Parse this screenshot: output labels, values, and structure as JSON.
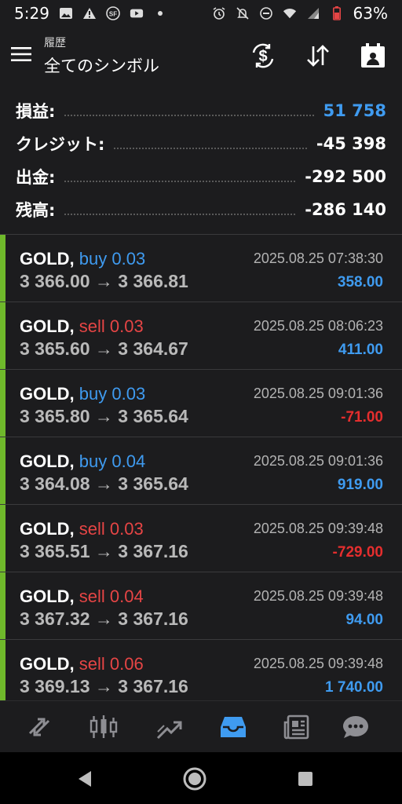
{
  "status_bar": {
    "time": "5:29",
    "battery": "63%",
    "icons_left": [
      "image-icon",
      "warning-icon",
      "sf-icon",
      "youtube-icon",
      "dot-icon"
    ],
    "icons_right": [
      "alarm-icon",
      "mute-icon",
      "dnd-icon",
      "wifi-icon",
      "signal-icon",
      "battery-icon"
    ]
  },
  "header": {
    "subtitle": "履歴",
    "title": "全てのシンボル",
    "buttons": [
      "currency-exchange-icon",
      "sort-icon",
      "calendar-icon"
    ]
  },
  "summary": [
    {
      "label": "損益:",
      "value": "51 758",
      "color": "#3f9bf0"
    },
    {
      "label": "クレジット:",
      "value": "-45 398",
      "color": "#ffffff"
    },
    {
      "label": "出金:",
      "value": "-292 500",
      "color": "#ffffff"
    },
    {
      "label": "残高:",
      "value": "-286 140",
      "color": "#ffffff"
    }
  ],
  "colors": {
    "buy": "#3f9bf0",
    "sell": "#e64545",
    "profit_positive": "#3f9bf0",
    "profit_negative": "#e52e2e",
    "accent_bar": "#6fb92b"
  },
  "trades": [
    {
      "symbol": "GOLD,",
      "side": "buy 0.03",
      "type": "buy",
      "prices": "3 366.00 → 3 366.81",
      "time": "2025.08.25 07:38:30",
      "profit": "358.00",
      "positive": true
    },
    {
      "symbol": "GOLD,",
      "side": "sell 0.03",
      "type": "sell",
      "prices": "3 365.60 → 3 364.67",
      "time": "2025.08.25 08:06:23",
      "profit": "411.00",
      "positive": true
    },
    {
      "symbol": "GOLD,",
      "side": "buy 0.03",
      "type": "buy",
      "prices": "3 365.80 → 3 365.64",
      "time": "2025.08.25 09:01:36",
      "profit": "-71.00",
      "positive": false
    },
    {
      "symbol": "GOLD,",
      "side": "buy 0.04",
      "type": "buy",
      "prices": "3 364.08 → 3 365.64",
      "time": "2025.08.25 09:01:36",
      "profit": "919.00",
      "positive": true
    },
    {
      "symbol": "GOLD,",
      "side": "sell 0.03",
      "type": "sell",
      "prices": "3 365.51 → 3 367.16",
      "time": "2025.08.25 09:39:48",
      "profit": "-729.00",
      "positive": false
    },
    {
      "symbol": "GOLD,",
      "side": "sell 0.04",
      "type": "sell",
      "prices": "3 367.32 → 3 367.16",
      "time": "2025.08.25 09:39:48",
      "profit": "94.00",
      "positive": true
    },
    {
      "symbol": "GOLD,",
      "side": "sell 0.06",
      "type": "sell",
      "prices": "3 369.13 → 3 367.16",
      "time": "2025.08.25 09:39:48",
      "profit": "1 740.00",
      "positive": true
    }
  ],
  "bottom_nav": {
    "items": [
      "quotes-icon",
      "chart-icon",
      "trade-icon",
      "history-icon",
      "news-icon",
      "chat-icon"
    ],
    "active": "history-icon"
  },
  "system_nav": [
    "back-icon",
    "home-icon",
    "recents-icon"
  ]
}
